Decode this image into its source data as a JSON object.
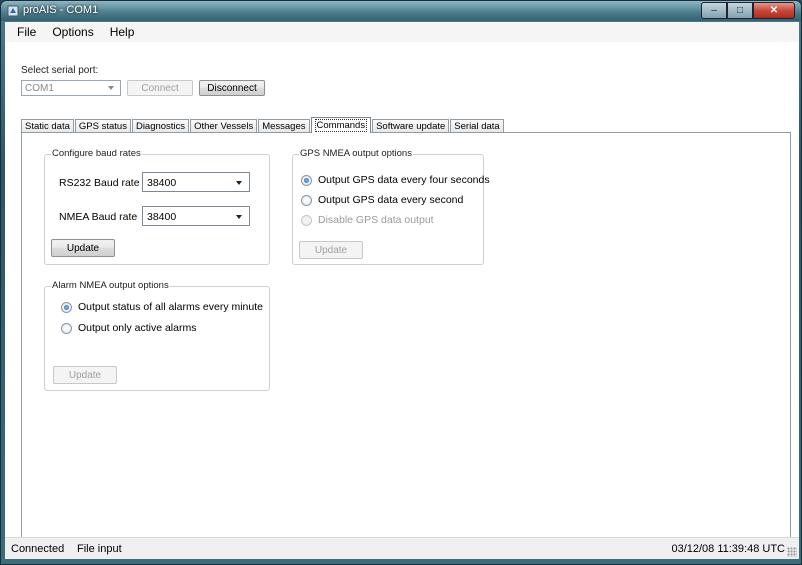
{
  "window": {
    "title": "proAIS - COM1",
    "caption_buttons": {
      "minimize": "–",
      "maximize": "□",
      "close": "✕"
    }
  },
  "menu": {
    "items": [
      "File",
      "Options",
      "Help"
    ]
  },
  "serial": {
    "label": "Select serial port:",
    "port_value": "COM1",
    "connect_label": "Connect",
    "disconnect_label": "Disconnect"
  },
  "tabs": [
    "Static data",
    "GPS status",
    "Diagnostics",
    "Other Vessels",
    "Messages",
    "Commands",
    "Software update",
    "Serial data"
  ],
  "active_tab": "Commands",
  "baud": {
    "group_title": "Configure baud rates",
    "rs232_label": "RS232 Baud rate",
    "rs232_value": "38400",
    "nmea_label": "NMEA Baud rate",
    "nmea_value": "38400",
    "update_label": "Update"
  },
  "gps_nmea": {
    "group_title": "GPS NMEA output options",
    "options": [
      "Output GPS data every four seconds",
      "Output GPS data every second",
      "Disable GPS data output"
    ],
    "selected_index": 0,
    "update_label": "Update"
  },
  "alarm_nmea": {
    "group_title": "Alarm NMEA output options",
    "options": [
      "Output status of all alarms every minute",
      "Output only active alarms"
    ],
    "selected_index": 0,
    "update_label": "Update"
  },
  "status": {
    "connection": "Connected",
    "input": "File input",
    "datetime": "03/12/08 11:39:48 UTC"
  },
  "icons": [
    "app-icon",
    "dropdown-arrow-icon",
    "resize-grip-icon"
  ]
}
